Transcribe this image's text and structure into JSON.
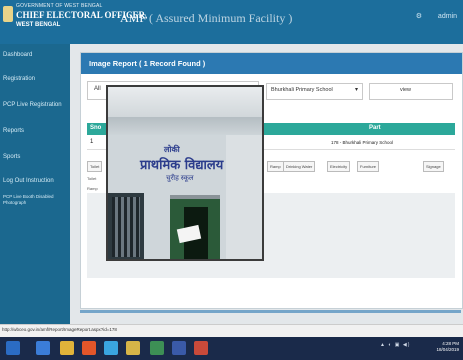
{
  "header": {
    "org_line1": "GOVERNMENT OF WEST BENGAL",
    "org_line2": "CHIEF ELECTORAL OFFICER,",
    "org_line3": "WEST BENGAL",
    "app_title": "AMF",
    "app_subtitle": "( Assured Minimum Facility )",
    "right_items": [
      "⚙",
      "admin"
    ]
  },
  "sidebar": {
    "items": [
      {
        "label": "Dashboard"
      },
      {
        "label": "Registration"
      },
      {
        "label": "PCP Live Registration"
      },
      {
        "label": "Reports"
      },
      {
        "label": "Sports"
      },
      {
        "label": "Log Out Instruction"
      },
      {
        "label": "PCP Live Booth Disabled Photograph"
      }
    ]
  },
  "report": {
    "panel_title": "Image Report ( 1 Record Found )",
    "filter_value": "All",
    "select_value": "Bhurkhali Primary School",
    "input_value": "view",
    "columns": [
      "Sno",
      "Part"
    ],
    "rows": [
      {
        "sno": "1",
        "part": "178 - Bhurkhali Primary School"
      }
    ],
    "tabs": [
      "Toilet",
      "Ramp",
      "Drinking Water",
      "Electricity",
      "Furniture",
      "Signage"
    ],
    "sub_a": "Toilet",
    "sub_b": "Ramp"
  },
  "photo": {
    "sign_line1": "लोकी",
    "sign_line2": "प्राथमिक विद्यालय",
    "sign_line3": "चुरीह स्कूल"
  },
  "browser": {
    "url": "http://wbceo.gov.in/amf/Report/ImageReport.aspx?id=178"
  },
  "taskbar": {
    "tray": "▲ ◐ ▣ ◀)",
    "time": "4:28 PM",
    "date": "18/04/2019"
  },
  "colors": {
    "header": "#1c6e9c",
    "sidebar": "#1b688f",
    "panel_header": "#2c79b2",
    "table_header": "#2ca89a",
    "taskbar": "#1a2a4a"
  }
}
